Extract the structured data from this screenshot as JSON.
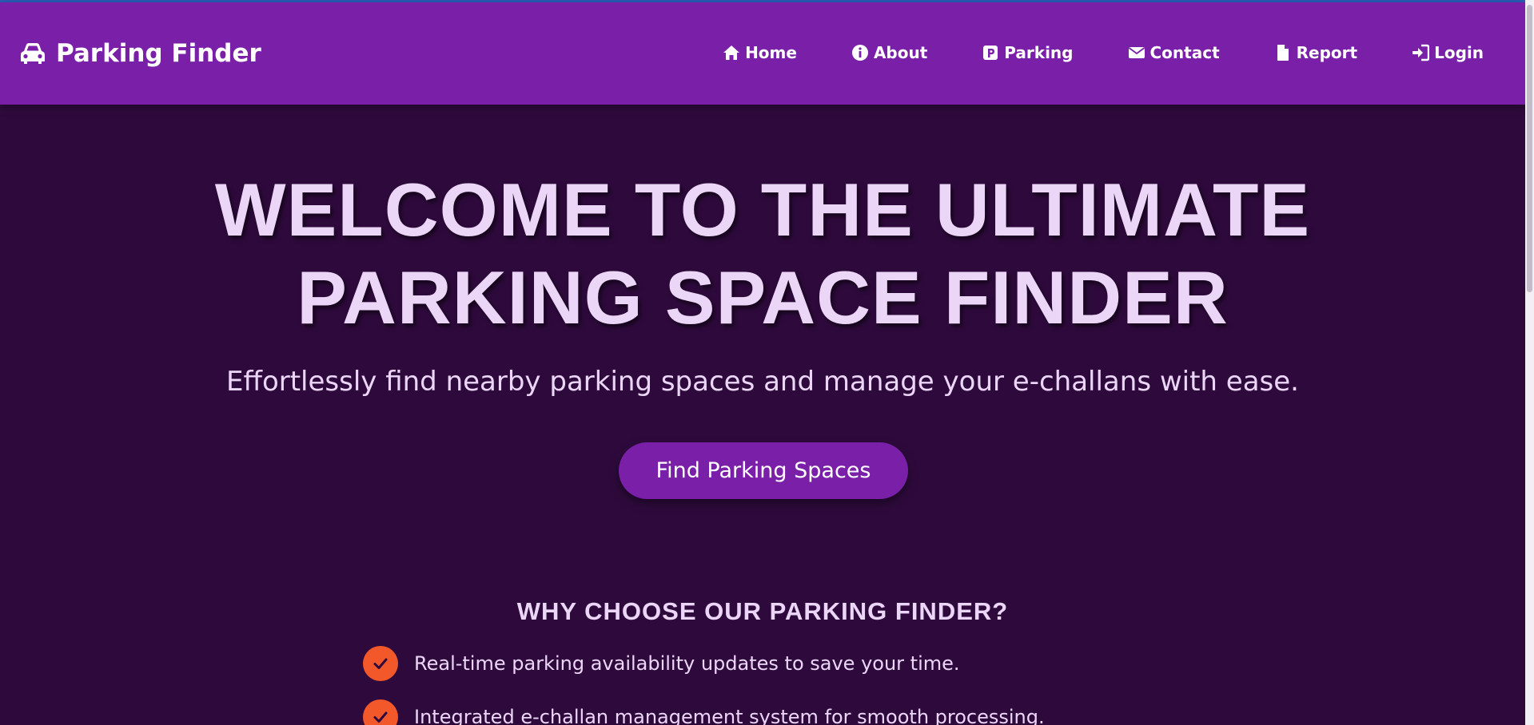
{
  "brand": {
    "label": "Parking Finder",
    "icon": "car-icon"
  },
  "nav": [
    {
      "label": "Home",
      "icon": "home-icon"
    },
    {
      "label": "About",
      "icon": "info-icon"
    },
    {
      "label": "Parking",
      "icon": "parking-icon"
    },
    {
      "label": "Contact",
      "icon": "envelope-icon"
    },
    {
      "label": "Report",
      "icon": "file-icon"
    },
    {
      "label": "Login",
      "icon": "login-icon"
    }
  ],
  "hero": {
    "title_line1": "WELCOME TO THE ULTIMATE",
    "title_line2": "PARKING SPACE FINDER",
    "subtitle": "Effortlessly find nearby parking spaces and manage your e-challans with ease.",
    "cta_label": "Find Parking Spaces"
  },
  "why": {
    "title": "WHY CHOOSE OUR PARKING FINDER?",
    "items": [
      "Real-time parking availability updates to save your time.",
      "Integrated e-challan management system for smooth processing."
    ]
  },
  "colors": {
    "navbar": "#7a1fa8",
    "background": "#2e0a3c",
    "heading_text": "#ecd6f7",
    "check_badge": "#f2582a"
  }
}
